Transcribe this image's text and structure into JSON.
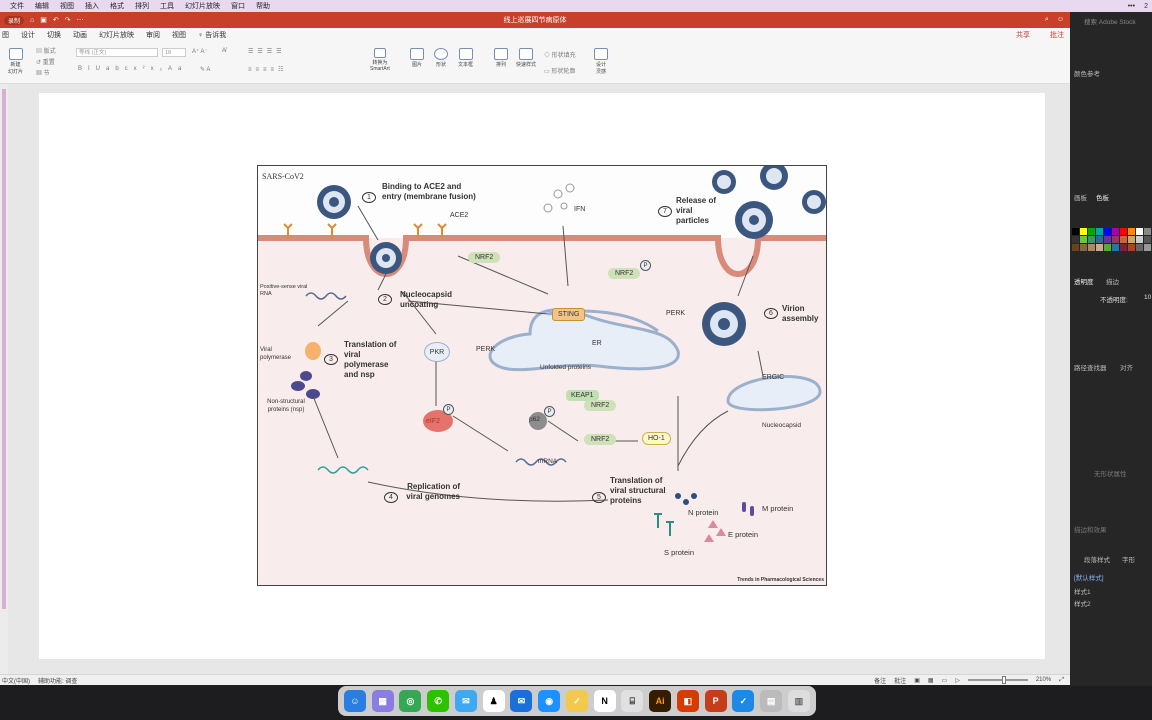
{
  "mac_menu": [
    "文件",
    "编辑",
    "视图",
    "插入",
    "格式",
    "排列",
    "工具",
    "幻灯片放映",
    "窗口",
    "帮助"
  ],
  "mac_right": [
    "•••",
    "2"
  ],
  "window": {
    "title": "线上巡展四节病原体",
    "recording": "录制"
  },
  "ribbon_tabs": [
    "图",
    "设计",
    "切换",
    "动画",
    "幻灯片放映",
    "审阅",
    "视图"
  ],
  "tell_me": "告诉我",
  "share_label": "共享",
  "comment_label": "批注",
  "ribbon": {
    "new_slide": "新建\n幻灯片",
    "layout": "版式",
    "reset": "重置",
    "section": "节",
    "font_name": "等线 (正文)",
    "font_size": "18",
    "convert_smartart": "转换为\nSmartArt",
    "picture": "图片",
    "shape": "形状",
    "textbox": "文本框",
    "arrange": "排列",
    "quick_styles": "快速样式",
    "shape_fill": "形状填充",
    "shape_outline": "形状轮廓",
    "designer": "设计\n灵感"
  },
  "figure": {
    "header": "SARS-CoV2",
    "credit": "Trends in Pharmacological Sciences",
    "steps": [
      {
        "n": "1",
        "label": "Binding to ACE2 and entry (membrane fusion)"
      },
      {
        "n": "2",
        "label": "Nucleocapsid uncoating"
      },
      {
        "n": "3",
        "label": "Translation of viral polymerase and nsp"
      },
      {
        "n": "4",
        "label": "Replication of viral genomes"
      },
      {
        "n": "5",
        "label": "Translation of viral structural proteins"
      },
      {
        "n": "6",
        "label": "Virion assembly"
      },
      {
        "n": "7",
        "label": "Release of viral particles"
      }
    ],
    "labels": {
      "ace2": "ACE2",
      "ifn": "IFN",
      "nrf2": "NRF2",
      "p": "P",
      "sting": "STING",
      "perk": "PERK",
      "er": "ER",
      "unfolded": "Unfolded proteins",
      "pkr": "PKR",
      "eif2": "eIF2",
      "p62": "p62",
      "keap1": "KEAP1",
      "ho1": "HO-1",
      "mrna": "mRNA",
      "ergic": "ERGIC",
      "nucleocapsid": "Nucleocapsid",
      "positive_rna": "Positive-sense viral RNA",
      "viral_polymerase": "Viral polymerase",
      "nsp": "Non-structural proteins (nsp)",
      "n_protein": "N protein",
      "m_protein": "M protein",
      "e_protein": "E protein",
      "s_protein": "S protein"
    }
  },
  "statusbar": {
    "lang": "中文(中国)",
    "accessibility": "辅助功能: 调查",
    "notes": "备注",
    "comments": "批注",
    "zoom": "210%"
  },
  "right_panel": {
    "search": "搜索 Adobe Stock",
    "items": [
      "颜色参考",
      "画板",
      "色板",
      "透明度",
      "描边",
      "不透明度:",
      "路径查找器",
      "对齐",
      "无形状属性",
      "段落样式",
      "字形",
      "描边和效果",
      "[默认样式]",
      "样式1",
      "样式2"
    ],
    "opacity_value": "10"
  },
  "dock_apps": [
    "finder",
    "launchpad",
    "chrome",
    "wechat",
    "messages",
    "qq",
    "mail",
    "safari",
    "notes",
    "notion",
    "word",
    "illustrator",
    "office",
    "powerpoint",
    "app-store",
    "vscode",
    "files",
    "trash"
  ]
}
